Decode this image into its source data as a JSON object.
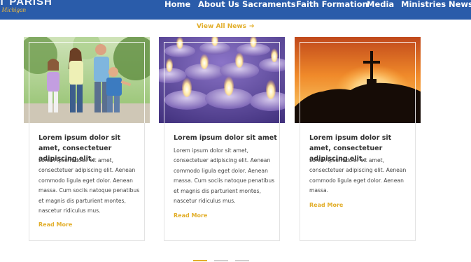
{
  "header": {
    "brand_name": "T PARISH",
    "brand_sub": "· Michigan",
    "nav": [
      "Home",
      "About Us",
      "Sacraments",
      "Faith Formation",
      "Media",
      "Ministries",
      "News"
    ]
  },
  "news": {
    "view_all_label": "View All News",
    "view_all_icon": "arrow-right-icon",
    "cards": [
      {
        "image": "family-running-photo",
        "title": "Lorem ipsum dolor sit amet, consectetuer adipiscing elit.",
        "text": "Lorem ipsum dolor sit amet, consectetuer adipiscing elit. Aenean commodo ligula eget dolor. Aenean massa. Cum sociis natoque penatibus et magnis dis parturient montes, nascetur ridiculus mus.",
        "link": "Read More"
      },
      {
        "image": "candles-photo",
        "title": "Lorem ipsum dolor sit amet",
        "text": "Lorem ipsum dolor sit amet, consectetuer adipiscing elit. Aenean commodo ligula eget dolor. Aenean massa. Cum sociis natoque penatibus et magnis dis parturient montes, nascetur ridiculus mus.",
        "link": "Read More"
      },
      {
        "image": "cross-sunset-photo",
        "title": "Lorem ipsum dolor sit amet, consectetuer adipiscing elit.",
        "text": "Lorem ipsum dolor sit amet, consectetuer adipiscing elit. Aenean commodo ligula eget dolor. Aenean massa.",
        "link": "Read More"
      }
    ]
  },
  "colors": {
    "header_bg": "#2a5caa",
    "accent": "#e2ae2a",
    "title_text": "#333333"
  }
}
